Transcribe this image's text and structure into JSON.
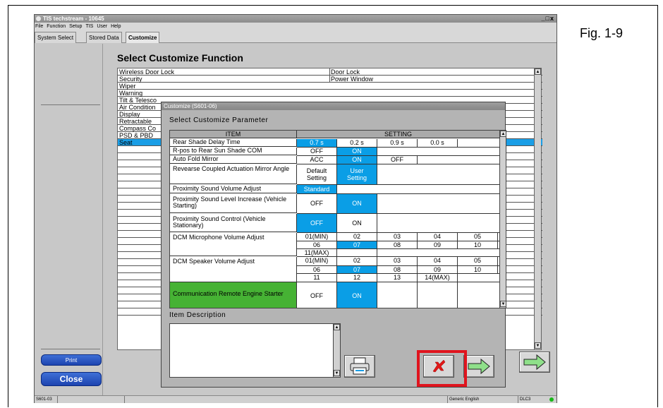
{
  "figure_label": "Fig. 1-9",
  "window": {
    "title": "TIS techstream - 10645",
    "controls": "_□x",
    "menu": [
      "File",
      "Function",
      "Setup",
      "TIS",
      "User",
      "Help"
    ],
    "tabs": [
      "System Select",
      "Stored Data",
      "Customize"
    ],
    "active_tab": "Customize"
  },
  "left_panel": {
    "print_label": "Print",
    "close_label": "Close"
  },
  "main": {
    "title": "Select Customize Function",
    "functions_left": [
      "Wireless Door Lock",
      "Security",
      "Wiper",
      "Warning",
      "Tilt & Telesco",
      "Air Condition",
      "Display",
      "Retractable",
      "Compass Co",
      "PSD & PBD",
      "Seat"
    ],
    "functions_right": [
      "Door Lock",
      "Power Window"
    ]
  },
  "dialog": {
    "title": "Customize (S601-06)",
    "subtitle": "Select Customize Parameter",
    "header_item": "ITEM",
    "header_setting": "SETTING",
    "rows": [
      {
        "item": "Rear Shade Delay Time",
        "values": [
          "0.7 s",
          "0.2 s",
          "0.9 s",
          "0.0 s"
        ]
      },
      {
        "item": "R-pos to Rear Sun Shade COM",
        "values": [
          "OFF",
          "ON"
        ]
      },
      {
        "item": "Auto Fold Mirror",
        "values": [
          "ACC",
          "ON",
          "OFF"
        ]
      },
      {
        "item": "Revearse Coupled Actuation Mirror Angle",
        "values": [
          "Default Setting",
          "User Setting"
        ]
      },
      {
        "item": "Proximity Sound Volume Adjust",
        "values": [
          "Standard"
        ]
      },
      {
        "item": "Proximity Sound Level Increase (Vehicle Starting)",
        "values": [
          "OFF",
          "ON"
        ]
      },
      {
        "item": "Proximity Sound Control (Vehicle Stationary)",
        "values": [
          "OFF",
          "ON"
        ]
      },
      {
        "item": "DCM Microphone Volume Adjust",
        "values": [
          "01(MIN)",
          "02",
          "03",
          "04",
          "05",
          "06",
          "07",
          "08",
          "09",
          "10",
          "11(MAX)"
        ]
      },
      {
        "item": "DCM Speaker Volume Adjust",
        "values": [
          "01(MIN)",
          "02",
          "03",
          "04",
          "05",
          "06",
          "07",
          "08",
          "09",
          "10",
          "11",
          "12",
          "13",
          "14(MAX)"
        ]
      },
      {
        "item": "Communication Remote Engine Starter",
        "values": [
          "OFF",
          "ON"
        ]
      }
    ],
    "description_label": "Item Description"
  },
  "status": {
    "code": "S601-03",
    "language": "Generic English",
    "interface": "DLC3"
  },
  "colors": {
    "selected_blue": "#0a9ee6",
    "highlight_green": "#46b234",
    "annotation_red": "#e0141e",
    "button_blue": "#1d44b0"
  }
}
